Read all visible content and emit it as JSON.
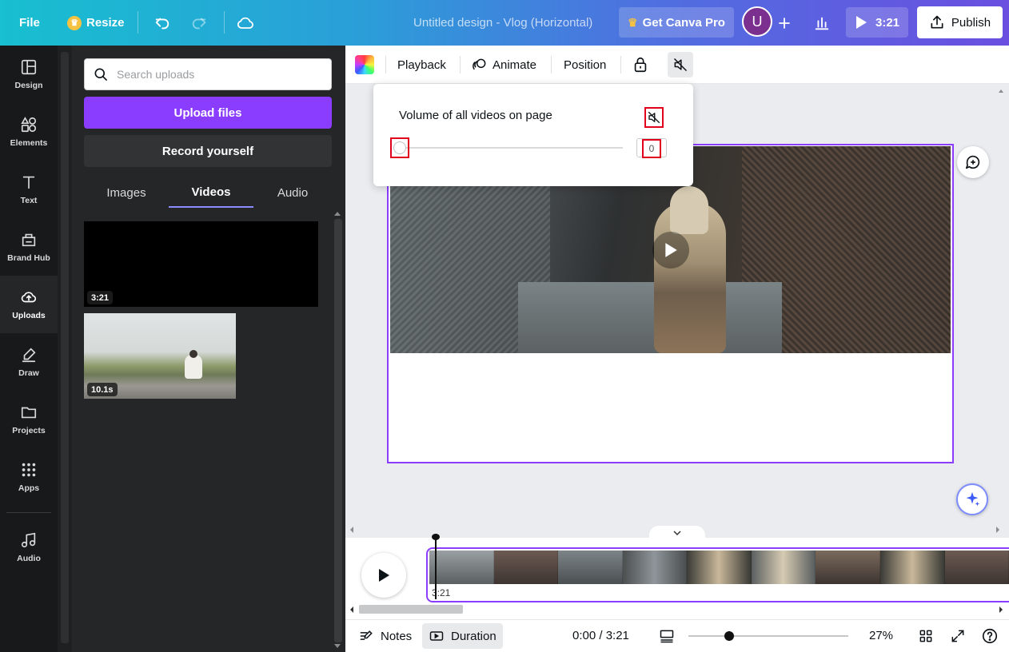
{
  "header": {
    "file_label": "File",
    "resize_label": "Resize",
    "design_title": "Untitled design - Vlog (Horizontal)",
    "get_pro_label": "Get Canva Pro",
    "avatar_initial": "U",
    "duration_label": "3:21",
    "publish_label": "Publish",
    "gradient_colors": [
      "#18bfd0",
      "#4f6fe0",
      "#6a4fe0"
    ]
  },
  "rail": {
    "items": [
      {
        "label": "Design",
        "icon": "design-icon"
      },
      {
        "label": "Elements",
        "icon": "elements-icon"
      },
      {
        "label": "Text",
        "icon": "text-icon"
      },
      {
        "label": "Brand Hub",
        "icon": "brand-hub-icon"
      },
      {
        "label": "Uploads",
        "icon": "uploads-icon",
        "active": true
      },
      {
        "label": "Draw",
        "icon": "draw-icon"
      },
      {
        "label": "Projects",
        "icon": "projects-icon"
      },
      {
        "label": "Apps",
        "icon": "apps-icon"
      },
      {
        "label": "Audio",
        "icon": "audio-icon"
      }
    ]
  },
  "uploads": {
    "search_placeholder": "Search uploads",
    "search_value": "",
    "upload_button": "Upload files",
    "record_button": "Record yourself",
    "tabs": [
      {
        "label": "Images",
        "active": false
      },
      {
        "label": "Videos",
        "active": true
      },
      {
        "label": "Audio",
        "active": false
      }
    ],
    "videos": [
      {
        "duration": "3:21"
      },
      {
        "duration": "10.1s"
      }
    ],
    "accent_color": "#8b3dff"
  },
  "toolbar": {
    "playback_label": "Playback",
    "animate_label": "Animate",
    "position_label": "Position"
  },
  "volume_popup": {
    "title": "Volume of all videos on page",
    "value": "0"
  },
  "timeline": {
    "clip_duration": "3:21"
  },
  "footer": {
    "notes_label": "Notes",
    "duration_label": "Duration",
    "time_readout": "0:00 / 3:21",
    "zoom_level": "27%"
  }
}
